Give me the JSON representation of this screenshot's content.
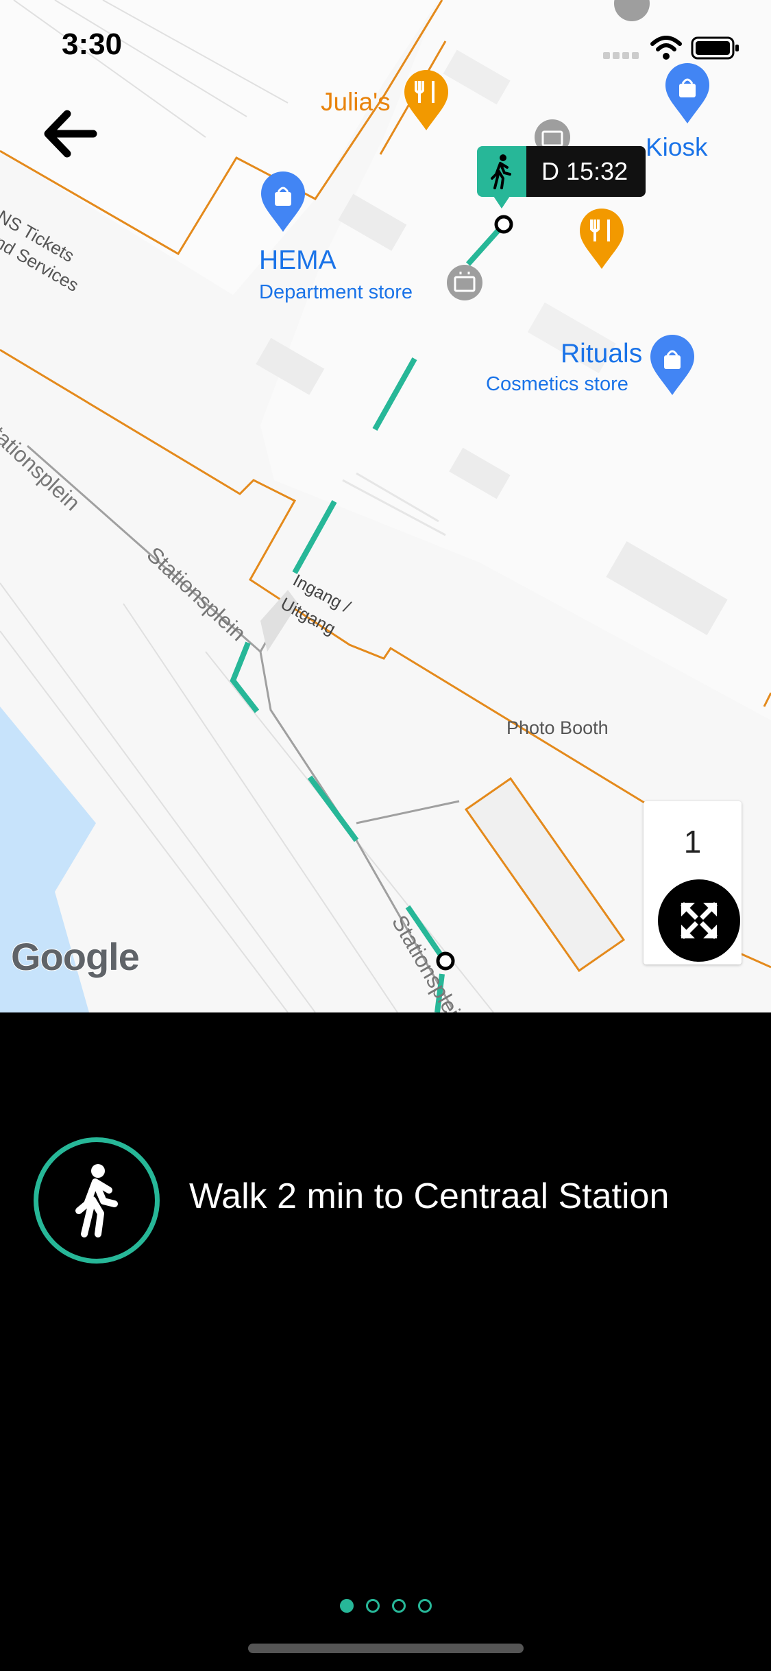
{
  "status_bar": {
    "time": "3:30"
  },
  "map": {
    "pois": [
      {
        "name": "Julia's",
        "type": "restaurant"
      },
      {
        "name": "Kiosk",
        "type": "shop"
      },
      {
        "name": "HEMA",
        "subtitle": "Department store",
        "type": "shop"
      },
      {
        "name": "Rituals",
        "subtitle": "Cosmetics store",
        "type": "shop"
      }
    ],
    "labels": {
      "ns_tickets_line1": "NS Tickets",
      "ns_tickets_line2": "and Services",
      "street_1": "Stationsplein",
      "street_2": "Stationsplein",
      "street_3": "Stationsplein",
      "entrance_line1": "Ingang /",
      "entrance_line2": "Uitgang",
      "photo_booth": "Photo Booth"
    },
    "departure_badge": "D 15:32",
    "floor_level": "1",
    "attribution": "Google"
  },
  "colors": {
    "route": "#27b798",
    "building_outline": "#e48a1c",
    "poi_blue": "#4285f4",
    "poi_orange": "#f29900",
    "water": "#c7e3fb"
  },
  "icons": {
    "back": "arrow-left-icon",
    "walk": "walking-person-icon",
    "expand": "expand-arrows-icon"
  },
  "instruction": {
    "text": "Walk 2 min to Centraal Station"
  },
  "pager": {
    "total": 4,
    "current": 1
  }
}
